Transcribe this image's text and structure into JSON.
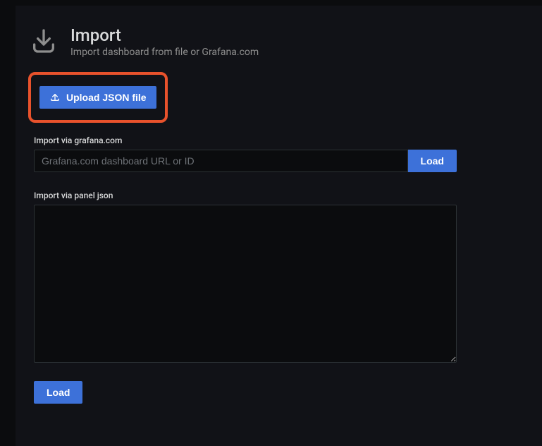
{
  "header": {
    "title": "Import",
    "subtitle": "Import dashboard from file or Grafana.com"
  },
  "upload": {
    "button_label": "Upload JSON file"
  },
  "via_url": {
    "label": "Import via grafana.com",
    "placeholder": "Grafana.com dashboard URL or ID",
    "load_label": "Load"
  },
  "via_json": {
    "label": "Import via panel json",
    "value": "",
    "load_label": "Load"
  },
  "colors": {
    "accent": "#3d71d9",
    "highlight": "#e8522c",
    "bg": "#111217"
  }
}
